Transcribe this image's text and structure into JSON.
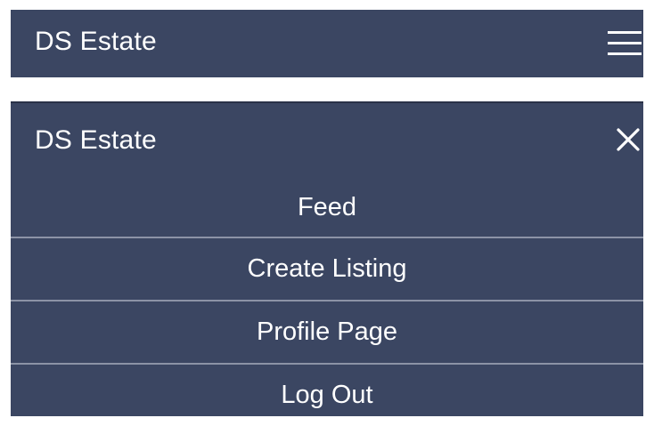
{
  "navbar_collapsed": {
    "brand": "DS Estate",
    "toggle_icon": "hamburger-menu-icon"
  },
  "navbar_expanded": {
    "brand": "DS Estate",
    "close_icon": "close-icon",
    "menu": [
      {
        "label": "Feed"
      },
      {
        "label": "Create Listing"
      },
      {
        "label": "Profile Page"
      },
      {
        "label": "Log Out"
      }
    ]
  },
  "colors": {
    "navbar_bg": "#3b4662",
    "text": "#ffffff",
    "divider": "#8c93a6"
  }
}
